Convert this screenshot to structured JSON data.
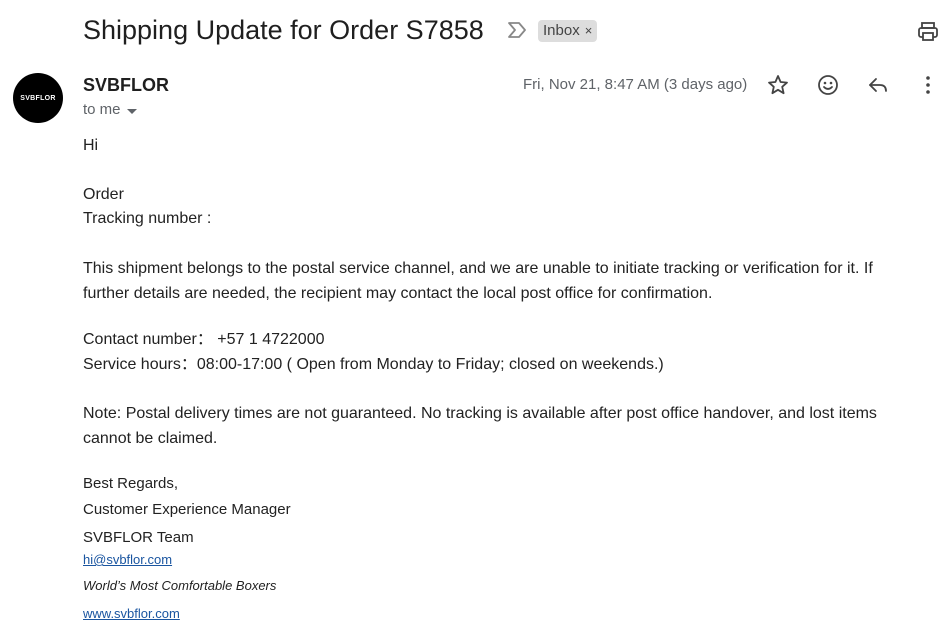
{
  "email": {
    "subject": "Shipping Update for Order S7858",
    "label_chip": "Inbox",
    "label_remove": "×",
    "sender_name": "SVBFLOR",
    "avatar_text": "SVBFLOR",
    "recipient": "to me",
    "date": "Fri, Nov 21, 8:47 AM (3 days ago)"
  },
  "body": {
    "greeting": "Hi",
    "order_line": "Order",
    "tracking_line": "Tracking number :",
    "paragraph": " This shipment belongs to the postal service channel, and we are unable to initiate tracking or verification for it. If further details are needed, the recipient may contact the local post office for confirmation.",
    "contact_line": "Contact number： +57 1 4722000",
    "hours_line": "Service hours：08:00-17:00  ( Open from Monday to Friday; closed on weekends.)",
    "note": "Note: Postal delivery times are not guaranteed. No tracking is available after post office handover, and lost items cannot be claimed."
  },
  "signature": {
    "closing": "Best Regards,",
    "title": "Customer Experience Manager",
    "team": "SVBFLOR Team",
    "email": "hi@svbflor.com",
    "tagline": "World’s Most Comfortable Boxers",
    "website": "www.svbflor.com"
  },
  "icons": {
    "label": "label-arrow-icon",
    "print": "print-icon",
    "star": "star-icon",
    "emoji": "emoji-icon",
    "reply": "reply-icon",
    "more": "more-vert-icon"
  }
}
